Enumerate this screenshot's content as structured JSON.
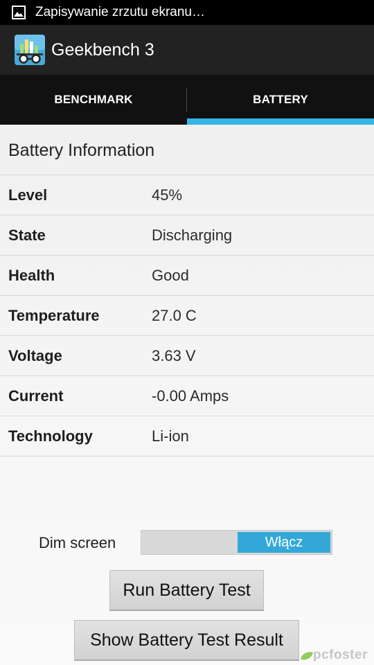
{
  "status_bar": {
    "notification_icon": "image-icon",
    "text": "Zapisywanie zrzutu ekranu…"
  },
  "app_bar": {
    "icon": "geekbench-icon",
    "title": "Geekbench 3"
  },
  "tabs": [
    {
      "label": "BENCHMARK",
      "selected": false
    },
    {
      "label": "BATTERY",
      "selected": true
    }
  ],
  "battery": {
    "section_title": "Battery Information",
    "rows": [
      {
        "label": "Level",
        "value": "45%"
      },
      {
        "label": "State",
        "value": "Discharging"
      },
      {
        "label": "Health",
        "value": "Good"
      },
      {
        "label": "Temperature",
        "value": "27.0 C"
      },
      {
        "label": "Voltage",
        "value": "3.63 V"
      },
      {
        "label": "Current",
        "value": "-0.00 Amps"
      },
      {
        "label": "Technology",
        "value": "Li-ion"
      }
    ]
  },
  "controls": {
    "dim_screen_label": "Dim screen",
    "dim_screen_toggle": "Włącz",
    "run_button": "Run Battery Test",
    "show_button": "Show Battery Test Result"
  },
  "watermark": "pcfoster",
  "colors": {
    "accent": "#33b5e5",
    "toggle_on": "#33a8d8",
    "status_bar": "#000000",
    "action_bar": "#222222",
    "tab_bar": "#111111"
  }
}
